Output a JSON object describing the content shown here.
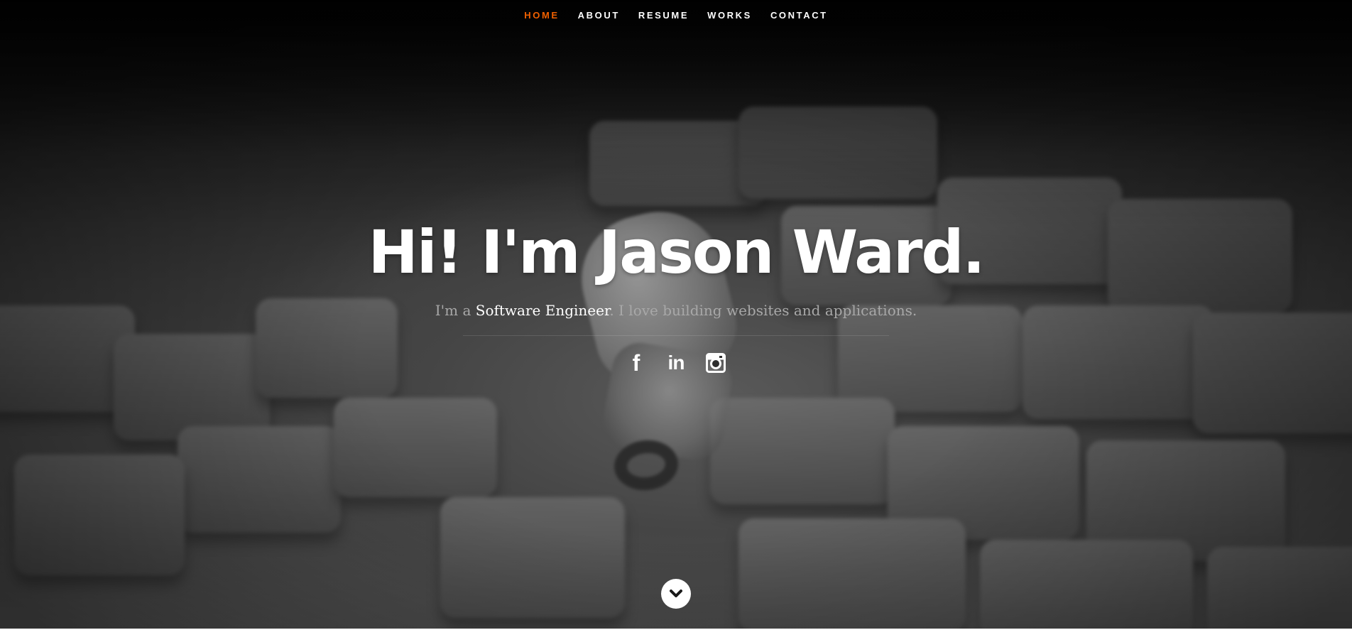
{
  "nav": {
    "items": [
      {
        "label": "HOME",
        "active": true
      },
      {
        "label": "ABOUT",
        "active": false
      },
      {
        "label": "RESUME",
        "active": false
      },
      {
        "label": "WORKS",
        "active": false
      },
      {
        "label": "CONTACT",
        "active": false
      }
    ],
    "active_color": "#f06000"
  },
  "banner": {
    "headline": "Hi! I'm Jason Ward.",
    "lead_prefix": "I'm a ",
    "lead_role": "Software Engineer",
    "lead_suffix": ". I love building websites and applications."
  },
  "social": {
    "icons": [
      "facebook-icon",
      "linkedin-icon",
      "instagram-icon"
    ],
    "facebook_glyph": "f",
    "linkedin_glyph": "in"
  },
  "scroll": {
    "icon": "chevron-down-icon"
  }
}
